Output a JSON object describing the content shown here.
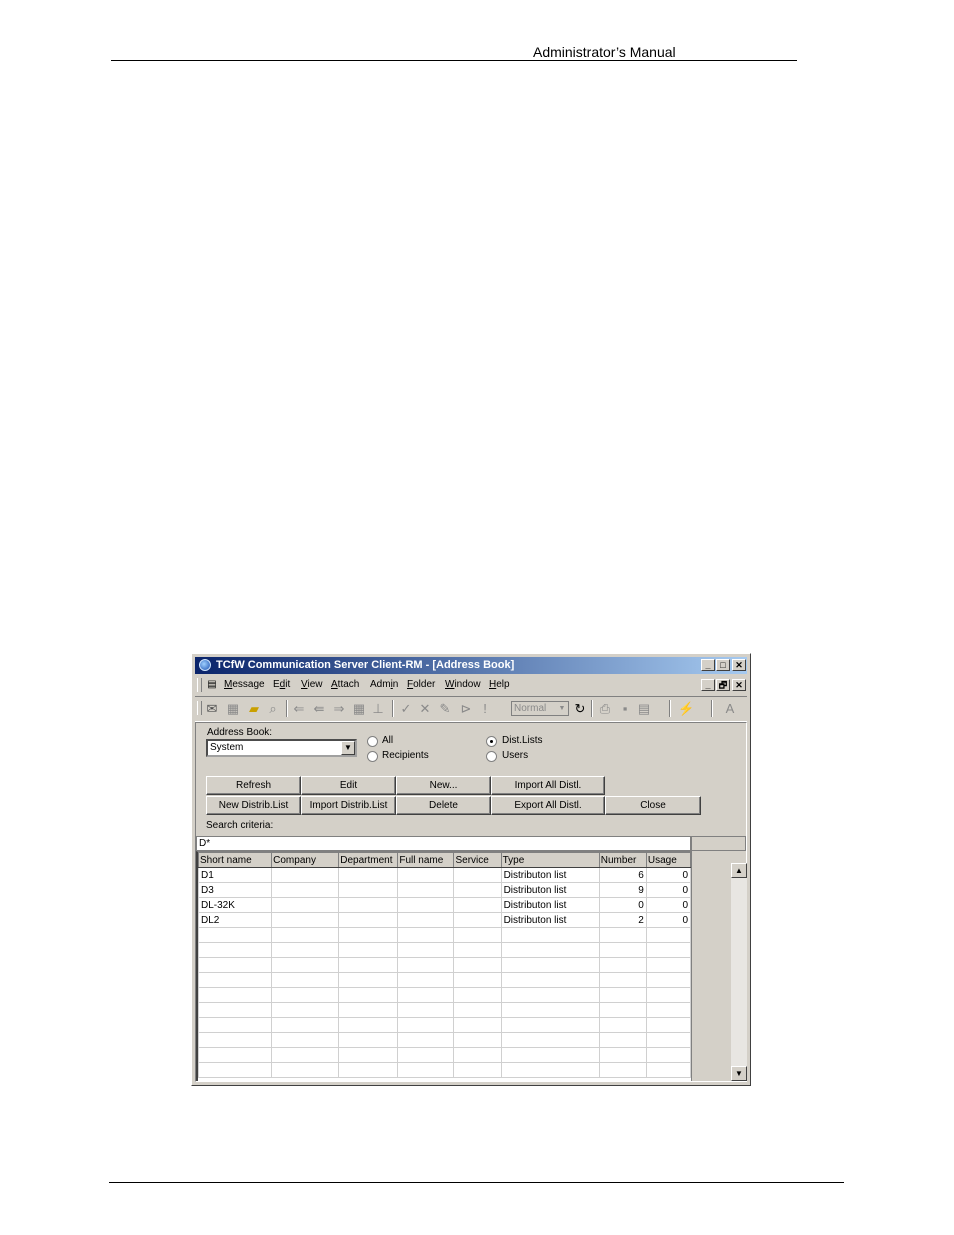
{
  "document": {
    "header": "Administrator’s Manual"
  },
  "window": {
    "title": "TCfW Communication Server Client-RM - [Address Book]",
    "caption_buttons": [
      "_",
      "□",
      "✕"
    ],
    "mdi_buttons": [
      "_",
      "🗗",
      "✕"
    ],
    "menu": [
      {
        "label": "Message",
        "key": "M"
      },
      {
        "label": "Edit",
        "key": "d"
      },
      {
        "label": "View",
        "key": "V"
      },
      {
        "label": "Attach",
        "key": "A"
      },
      {
        "label": "Admin",
        "key": "i"
      },
      {
        "label": "Folder",
        "key": "F"
      },
      {
        "label": "Window",
        "key": "W"
      },
      {
        "label": "Help",
        "key": "H"
      }
    ],
    "toolbar": {
      "priority_combo": "Normal",
      "icons": [
        "new-message-icon",
        "sent-icon",
        "open-folder-icon",
        "find-icon",
        "reply-icon",
        "reply-all-icon",
        "forward-icon",
        "address-icon",
        "stamp-icon",
        "check-icon",
        "cancel-icon",
        "pen-icon",
        "next-icon",
        "urgent-icon",
        "refresh-icon",
        "print-icon",
        "save-icon",
        "document-icon",
        "send-receive-icon",
        "spell-icon"
      ]
    },
    "address_book": {
      "label": "Address Book:",
      "selected": "System",
      "filter_radios": [
        {
          "label": "All",
          "checked": false
        },
        {
          "label": "Recipients",
          "checked": false
        }
      ],
      "type_radios": [
        {
          "label": "Dist.Lists",
          "checked": true
        },
        {
          "label": "Users",
          "checked": false
        }
      ],
      "buttons_row1": [
        "Refresh",
        "Edit",
        "New...",
        "Import All Distl."
      ],
      "buttons_row2": [
        "New Distrib.List",
        "Import Distrib.List",
        "Delete",
        "Export All Distl.",
        "Close"
      ],
      "search_label": "Search criteria:",
      "search_value": "D*",
      "columns": [
        "Short name",
        "Company",
        "Department",
        "Full name",
        "Service",
        "Type",
        "Number",
        "Usage"
      ],
      "rows": [
        [
          "D1",
          "",
          "",
          "",
          "",
          "Distributon list",
          "6",
          "0"
        ],
        [
          "D3",
          "",
          "",
          "",
          "",
          "Distributon list",
          "9",
          "0"
        ],
        [
          "DL-32K",
          "",
          "",
          "",
          "",
          "Distributon list",
          "0",
          "0"
        ],
        [
          "DL2",
          "",
          "",
          "",
          "",
          "Distributon list",
          "2",
          "0"
        ]
      ],
      "empty_rows": 10
    }
  }
}
